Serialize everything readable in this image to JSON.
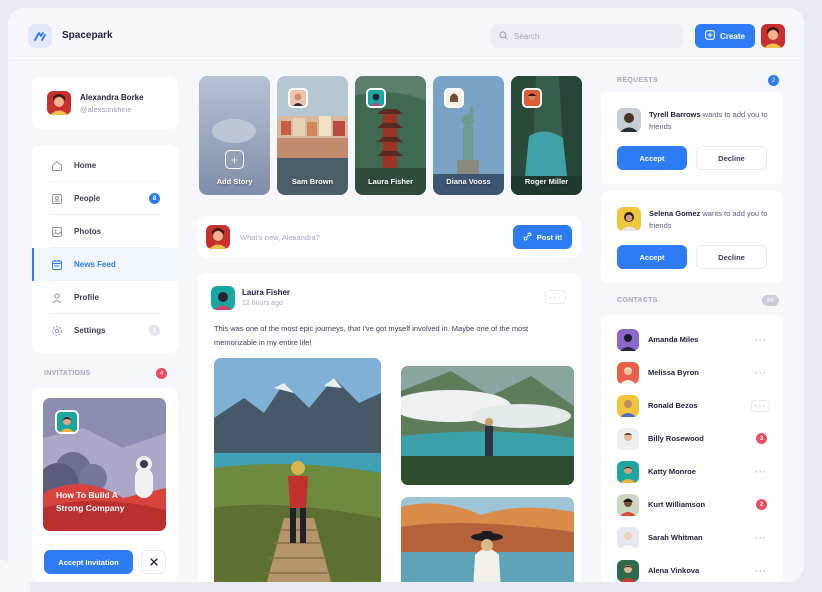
{
  "app": {
    "name": "Spacepark"
  },
  "header": {
    "search_placeholder": "Search",
    "create_label": "Create"
  },
  "user": {
    "name": "Alexandra Borke",
    "handle": "@alexsunshine"
  },
  "nav": {
    "items": [
      {
        "label": "Home",
        "icon": "home-icon"
      },
      {
        "label": "People",
        "icon": "people-icon",
        "badge": "8"
      },
      {
        "label": "Photos",
        "icon": "photos-icon"
      },
      {
        "label": "News Feed",
        "icon": "news-feed-icon",
        "active": true
      },
      {
        "label": "Profile",
        "icon": "profile-icon"
      },
      {
        "label": "Settings",
        "icon": "settings-icon",
        "badge": "1"
      }
    ]
  },
  "invitations": {
    "label": "INVITATIONS",
    "count": "4",
    "card_title": "How To Build A Strong Company",
    "accept_label": "Accept Invitation"
  },
  "stories": [
    {
      "name": "Add Story"
    },
    {
      "name": "Sam Brown"
    },
    {
      "name": "Laura Fisher"
    },
    {
      "name": "Diana Vooss"
    },
    {
      "name": "Roger Miller"
    }
  ],
  "composer": {
    "placeholder": "What's new, Alexandra?",
    "post_label": "Post it!"
  },
  "post": {
    "author": "Laura Fisher",
    "time": "12 hours ago",
    "text": "This was one of the most epic journeys, that I've got myself involved in. Maybe one of the most memorizable in my entire life!"
  },
  "requests": {
    "label": "REQUESTS",
    "count": "2",
    "items": [
      {
        "name": "Tyrell Barrows",
        "text": " wants to add you to friends",
        "accept": "Accept",
        "decline": "Decline"
      },
      {
        "name": "Selena Gomez",
        "text": " wants to add you to friends",
        "accept": "Accept",
        "decline": "Decline"
      }
    ]
  },
  "contacts": {
    "label": "CONTACTS",
    "count": "68",
    "items": [
      {
        "name": "Amanda Miles"
      },
      {
        "name": "Melissa Byron"
      },
      {
        "name": "Ronald Bezos"
      },
      {
        "name": "Billy Rosewood",
        "badge": "3"
      },
      {
        "name": "Katty Monroe"
      },
      {
        "name": "Kurt Williamson",
        "badge": "2"
      },
      {
        "name": "Sarah Whitman"
      },
      {
        "name": "Alena Vinkova"
      }
    ]
  },
  "colors": {
    "accent": "#2d7cf6",
    "alert": "#ee4d5f",
    "background": "#f6f7fb"
  }
}
